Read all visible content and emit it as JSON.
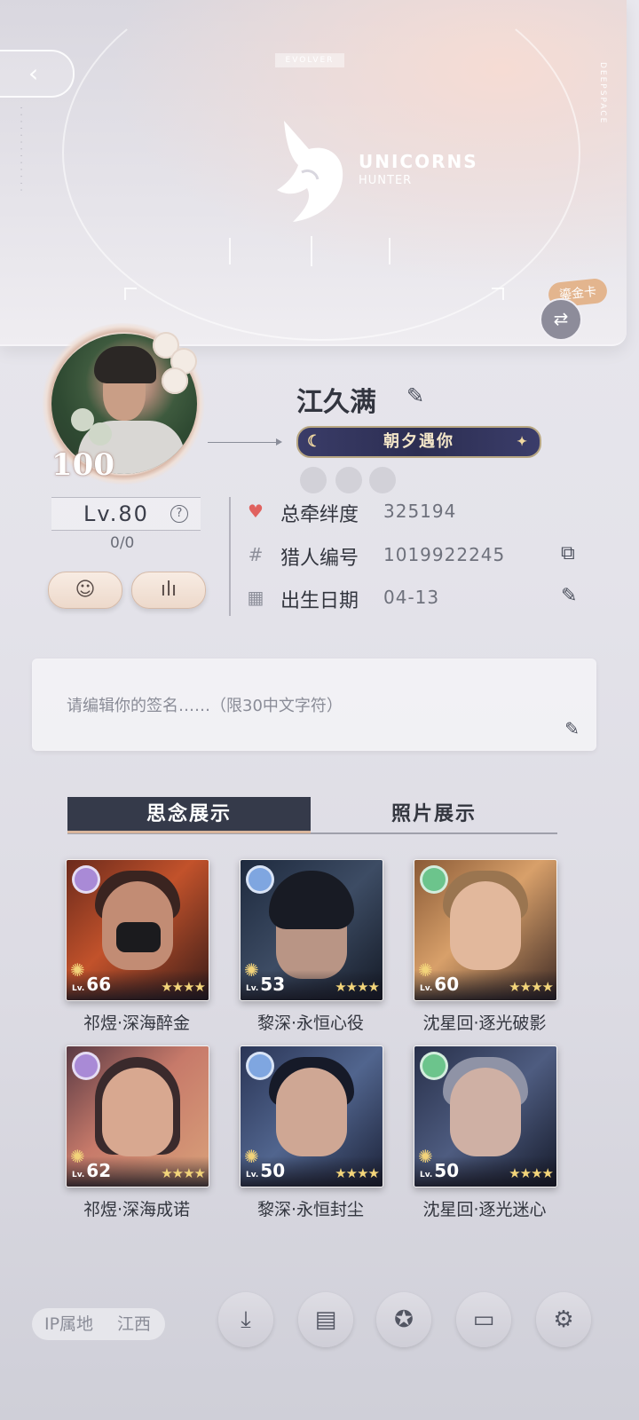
{
  "banner": {
    "back_icon": "back-chevron-icon",
    "evolver_text": "EVOLVER",
    "deepspace_text": "DEEPSPACE",
    "logo_title": "UNICORNS",
    "logo_subtitle": "HUNTER",
    "card_tag": "鎏金卡",
    "swap_icon": "swap-arrows-icon"
  },
  "profile": {
    "avatar_badge": "100",
    "name": "江久满",
    "title_badge": "朝夕遇你",
    "level": "Lv.80",
    "exp": "0/0"
  },
  "stats": [
    {
      "label": "总牵绊度",
      "value": "325194",
      "icon": "heart-icon",
      "icon_color": "#e0625f"
    },
    {
      "label": "猎人编号",
      "value": "1019922245",
      "icon": "hash-icon",
      "icon_color": "#8d8f9a",
      "action": "copy-icon"
    },
    {
      "label": "出生日期",
      "value": "04-13",
      "icon": "cake-icon",
      "icon_color": "#8d8f9a",
      "action": "edit-icon"
    }
  ],
  "signature": {
    "placeholder": "请编辑你的签名……（限30中文字符）"
  },
  "tabs": {
    "active": "思念展示",
    "inactive": "照片展示"
  },
  "cards": [
    {
      "name": "祁煜·深海醉金",
      "level": "66",
      "lv_prefix": "Lv.",
      "stars": "★★★★",
      "rarity_color": "#a98ad6"
    },
    {
      "name": "黎深·永恒心役",
      "level": "53",
      "lv_prefix": "Lv.",
      "stars": "★★★★",
      "rarity_color": "#7fa6e0"
    },
    {
      "name": "沈星回·逐光破影",
      "level": "60",
      "lv_prefix": "Lv.",
      "stars": "★★★★",
      "rarity_color": "#6cc48c"
    },
    {
      "name": "祁煜·深海成诺",
      "level": "62",
      "lv_prefix": "Lv.",
      "stars": "★★★★",
      "rarity_color": "#a98ad6"
    },
    {
      "name": "黎深·永恒封尘",
      "level": "50",
      "lv_prefix": "Lv.",
      "stars": "★★★★",
      "rarity_color": "#7fa6e0"
    },
    {
      "name": "沈星回·逐光迷心",
      "level": "50",
      "lv_prefix": "Lv.",
      "stars": "★★★★",
      "rarity_color": "#6cc48c"
    }
  ],
  "footer": {
    "ip_label": "IP属地",
    "ip_value": "江西",
    "buttons": [
      "download-icon",
      "billboard-icon",
      "badge-icon",
      "briefcase-icon",
      "settings-gear-icon"
    ]
  }
}
